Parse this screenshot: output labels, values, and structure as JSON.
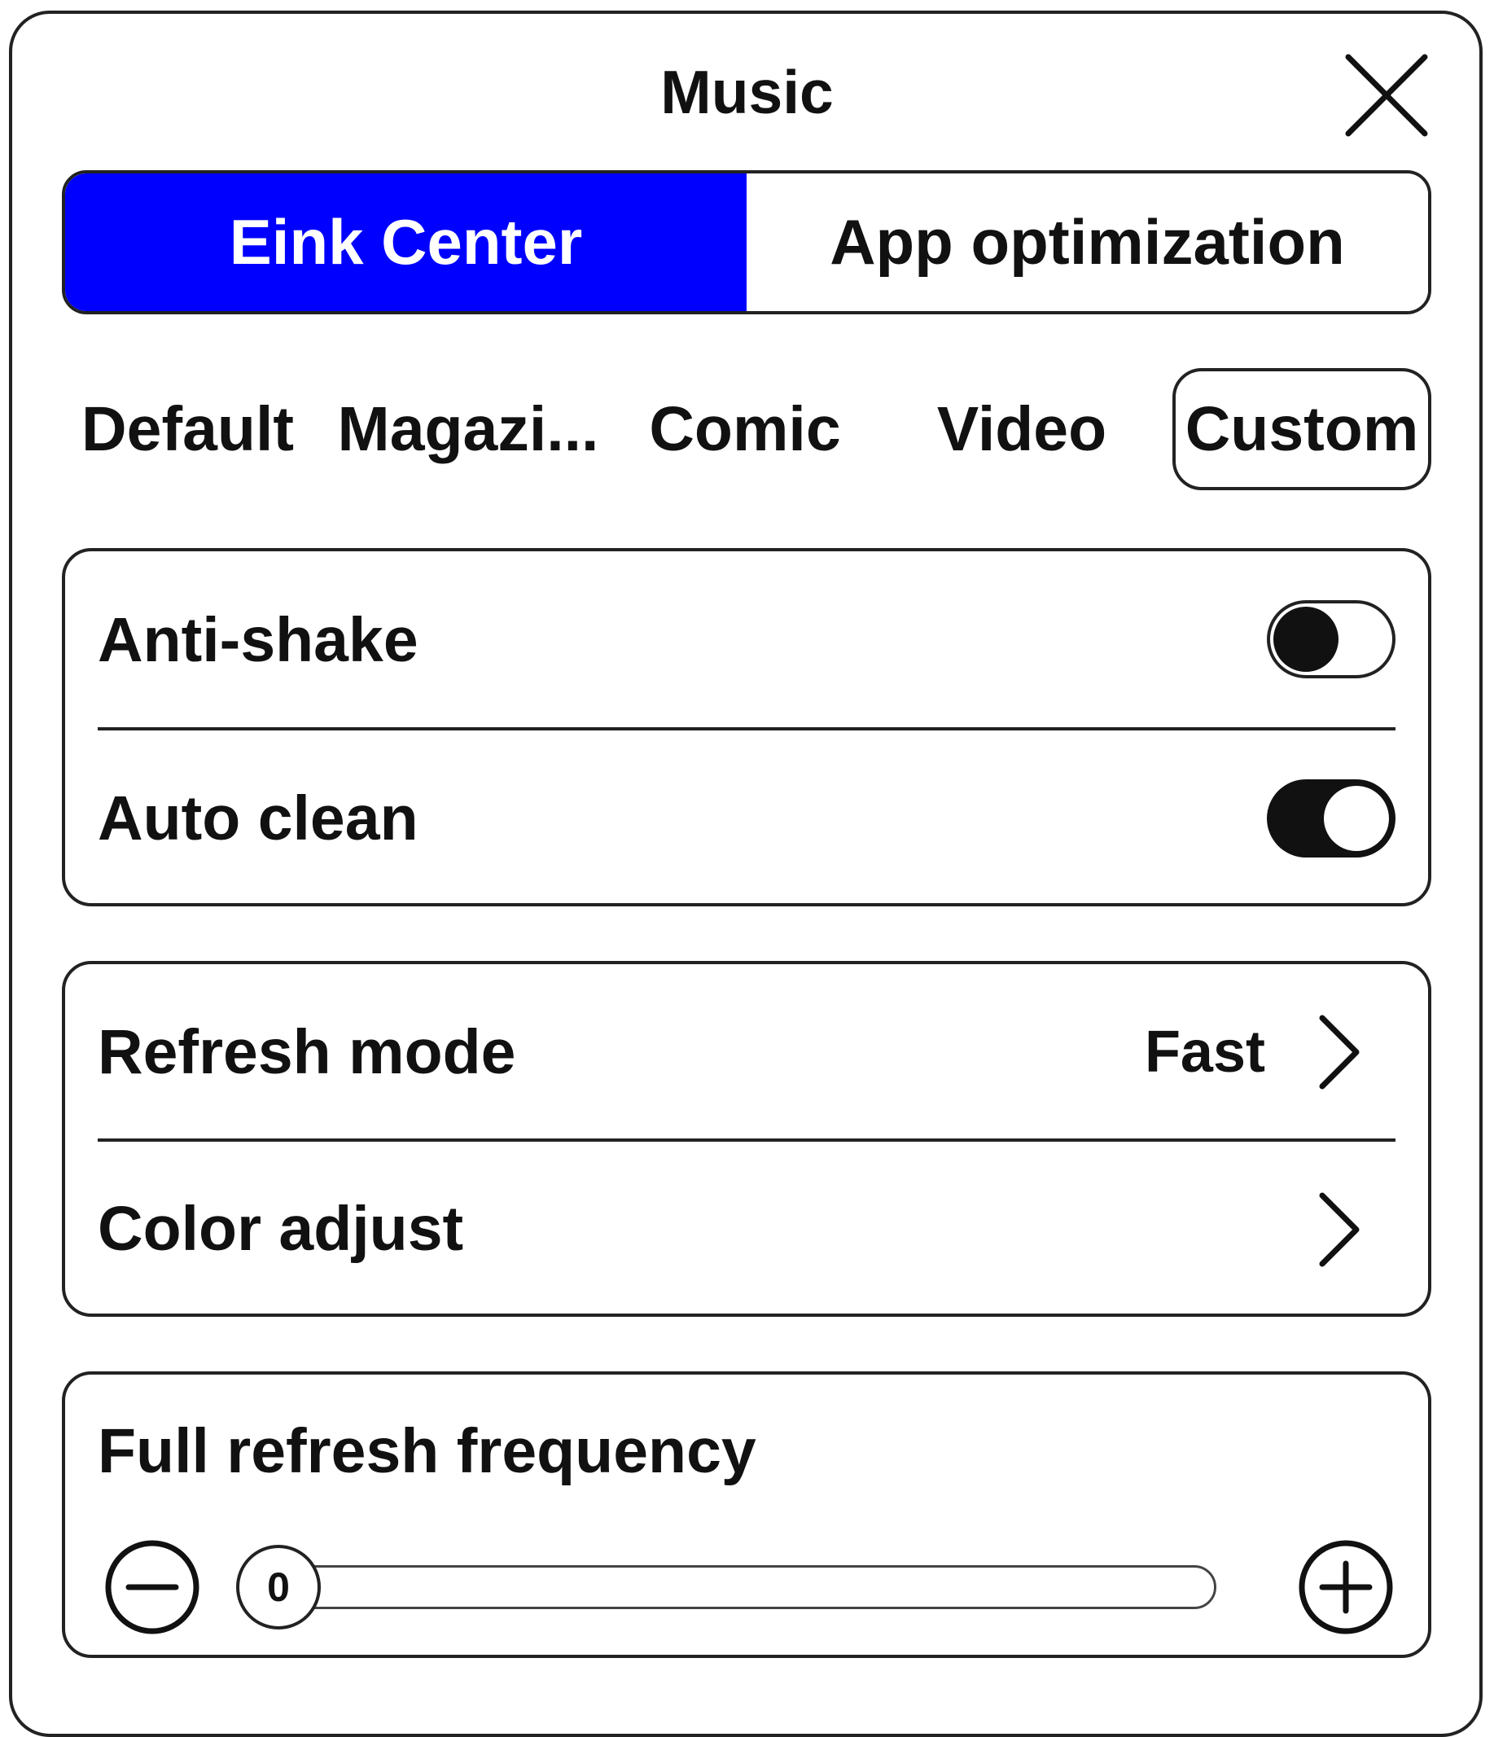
{
  "dialog": {
    "title": "Music",
    "close_icon": "close-icon"
  },
  "segment": {
    "tabs": [
      {
        "label": "Eink Center",
        "active": true
      },
      {
        "label": "App optimization",
        "active": false
      }
    ],
    "accent_color": "#0000ff"
  },
  "modes": {
    "items": [
      {
        "label": "Default",
        "selected": false
      },
      {
        "label": "Magazi...",
        "selected": false
      },
      {
        "label": "Comic",
        "selected": false
      },
      {
        "label": "Video",
        "selected": false
      },
      {
        "label": "Custom",
        "selected": true
      }
    ]
  },
  "toggles_card": {
    "anti_shake": {
      "label": "Anti-shake",
      "on": false
    },
    "auto_clean": {
      "label": "Auto clean",
      "on": true
    }
  },
  "settings_card": {
    "refresh_mode": {
      "label": "Refresh mode",
      "value": "Fast",
      "icon": "chevron-right-icon"
    },
    "color_adjust": {
      "label": "Color adjust",
      "icon": "chevron-right-icon"
    }
  },
  "frequency_card": {
    "label": "Full refresh frequency",
    "value": "0",
    "decrease_icon": "minus-circle-icon",
    "increase_icon": "plus-circle-icon"
  }
}
